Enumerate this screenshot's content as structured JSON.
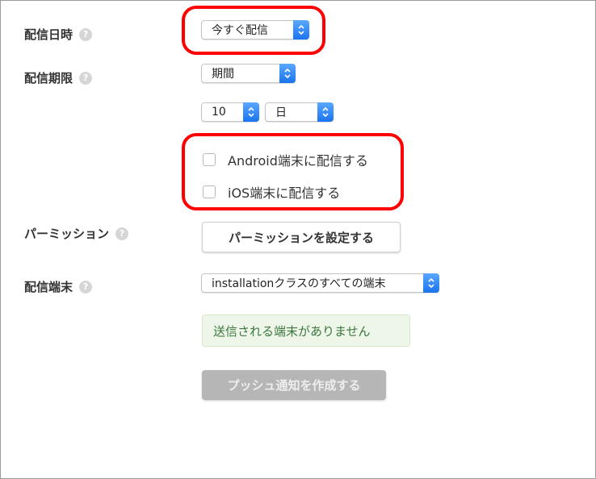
{
  "labels": {
    "delivery_datetime": "配信日時",
    "delivery_period": "配信期限",
    "permission": "パーミッション",
    "delivery_device": "配信端末"
  },
  "help_glyph": "?",
  "selects": {
    "delivery_datetime": "今すぐ配信",
    "period_type": "期間",
    "period_amount": "10",
    "period_unit": "日",
    "device_target": "installationクラスのすべての端末"
  },
  "checkboxes": {
    "android": {
      "label": "Android端末に配信する",
      "checked": false
    },
    "ios": {
      "label": "iOS端末に配信する",
      "checked": false
    }
  },
  "buttons": {
    "set_permission": "パーミッションを設定する",
    "create_push": "プッシュ通知を作成する"
  },
  "alert": "送信される端末がありません",
  "colors": {
    "highlight": "#ff0000",
    "stepper_blue": "#1a74ee",
    "alert_bg": "#eef6e9",
    "disabled_button": "#b6b6b6"
  },
  "icons": {
    "help": "question-circle-icon",
    "stepper": "chevron-up-down-icon"
  }
}
